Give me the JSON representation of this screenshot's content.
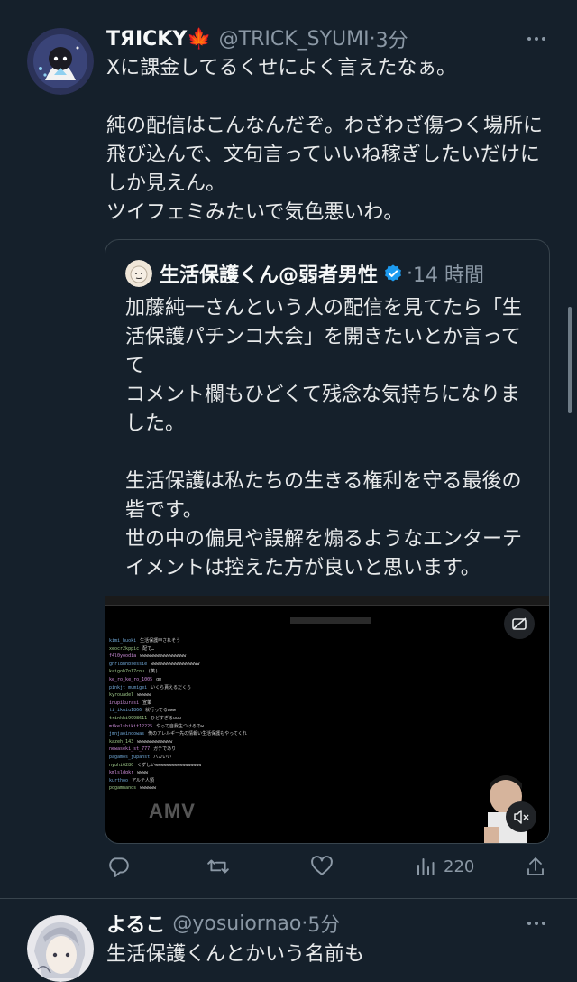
{
  "tweet": {
    "display_name": "TЯICKY🍁",
    "handle": "@TRICK_SYUMI",
    "separator": "·",
    "time": "3分",
    "text": "Xに課金してるくせによく言えたなぁ。\n\n純の配信はこんなんだぞ。わざわざ傷つく場所に飛び込んで、文句言っていいね稼ぎしたいだけにしか見えん。\nツイフェミみたいで気色悪いわ。",
    "quote": {
      "display_name": "生活保護くん@弱者男性",
      "separator": "·",
      "time": "14 時間",
      "text": "加藤純一さんという人の配信を見てたら「生活保護パチンコ大会」を開きたいとか言ってて\nコメント欄もひどくて残念な気持ちになりました。\n\n生活保護は私たちの生きる権利を守る最後の砦です。\n世の中の偏見や誤解を煽るようなエンターテイメントは控えた方が良いと思います。",
      "media": {
        "watermark": "AMV",
        "chat_lines": [
          {
            "user": "kimi_huoki",
            "msg": "生活保護申されそう"
          },
          {
            "user": "xeocr2kppic",
            "msg": "配で…"
          },
          {
            "user": "f4l0yoodia",
            "msg": "wwwwwwwwwwwwwwwww"
          },
          {
            "user": "gnrl8hhbsessie",
            "msg": "wwwwwwwwwwwwwwwwww"
          },
          {
            "user": "kaigoh7nl7cnu",
            "msg": "(笑)"
          },
          {
            "user": "ke_ro_ke_ro_1005",
            "msg": "gm"
          },
          {
            "user": "pinkjt_mumigei",
            "msg": "いくら貰えるだくら"
          },
          {
            "user": "kyrouadel",
            "msg": "wwwww"
          },
          {
            "user": "inupikurasi",
            "msg": "宣策"
          },
          {
            "user": "ti_ikuiu1866",
            "msg": "就行ってるwww"
          },
          {
            "user": "trinkhi9998611",
            "msg": "ひどすぎるwww"
          },
          {
            "user": "mikelshikit12225",
            "msg": "やって自我生つけるのw"
          },
          {
            "user": "jmnjaoinoowas",
            "msg": "俺のアレルギー先の情報い生活保護もやってくれ"
          },
          {
            "user": "kazeh_143",
            "msg": "wwwwwwwwwwwww"
          },
          {
            "user": "newaseki_st_777",
            "msg": "ガチであり"
          },
          {
            "user": "pagamos_jupanst",
            "msg": "バカいい"
          },
          {
            "user": "nyuhi6280",
            "msg": "くずしいwwwwwwwwwwwwwwwww"
          },
          {
            "user": "kmlsldgkr",
            "msg": "wwww"
          },
          {
            "user": "kurthoo",
            "msg": "アルテ人類"
          },
          {
            "user": "pogamnanos",
            "msg": "wwwwww"
          }
        ]
      }
    },
    "actions": {
      "views": "220"
    }
  },
  "tweet2": {
    "display_name": "よるこ",
    "handle": "@yosuiornao",
    "separator": "·",
    "time": "5分",
    "text": "生活保護くんとかいう名前も"
  },
  "colors": {
    "background": "#15202b",
    "text": "#e7e9ea",
    "muted": "#8b98a5",
    "border": "#38444d",
    "verified": "#1d9bf0"
  }
}
